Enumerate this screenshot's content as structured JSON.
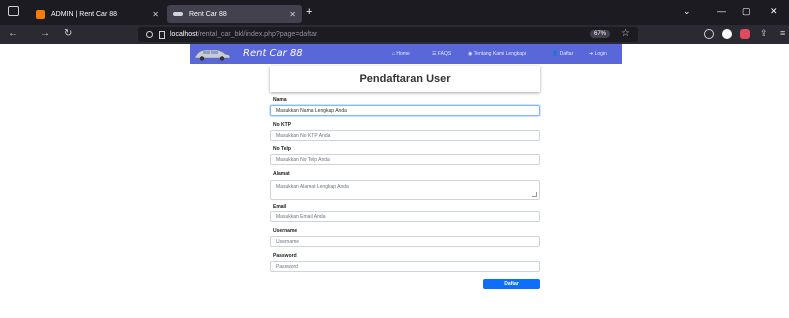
{
  "browser": {
    "tabs": [
      {
        "label": "ADMIN | Rent Car 88"
      },
      {
        "label": "Rent Car 88"
      }
    ],
    "new_tab_label": "+",
    "url_host": "localhost",
    "url_path": "/rental_car_bkl/index.php?page=daftar",
    "zoom": "67%"
  },
  "site": {
    "brand": "Rent Car 88",
    "menu": [
      {
        "label": "Home"
      },
      {
        "label": "FAQS"
      },
      {
        "label": "Tentang Kami Lengkapi"
      },
      {
        "label": "Daftar"
      },
      {
        "label": "Login"
      }
    ]
  },
  "form": {
    "title": "Pendaftaran User",
    "fields": [
      {
        "label": "Nama",
        "placeholder": "Masukkan Nama Lengkap Anda"
      },
      {
        "label": "No KTP",
        "placeholder": "Masukkan No KTP Anda"
      },
      {
        "label": "No Telp",
        "placeholder": "Masukkan No Telp Anda"
      },
      {
        "label": "Alamat",
        "placeholder": "Masukkan Alamat Lengkap Anda"
      },
      {
        "label": "Email",
        "placeholder": "Masukkan Email Anda"
      },
      {
        "label": "Username",
        "placeholder": "Username"
      },
      {
        "label": "Password",
        "placeholder": "Password"
      }
    ],
    "submit_label": "Daftar"
  },
  "colors": {
    "navbar": "#5a67d8",
    "primary_button": "#0d6efd"
  }
}
